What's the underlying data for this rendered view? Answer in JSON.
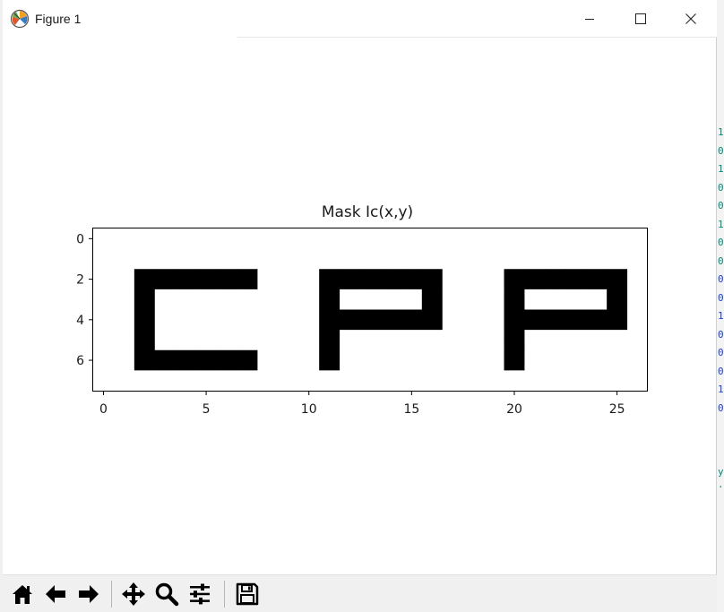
{
  "window": {
    "title": "Figure 1",
    "app_icon": "matplotlib-icon",
    "controls": [
      "minimize-icon",
      "maximize-icon",
      "close-icon"
    ]
  },
  "background_app": {
    "digits_teal": [
      "1",
      "0",
      "1",
      "0",
      "0",
      "1",
      "0",
      "0"
    ],
    "digits_blue": [
      "0",
      "0",
      "1",
      "0",
      "0",
      "0",
      "1",
      "0"
    ],
    "tail": [
      "y",
      "."
    ]
  },
  "chart_data": {
    "type": "heatmap",
    "title": "Mask Ic(x,y)",
    "colormap": "gray_r",
    "rows": 7,
    "cols": 27,
    "xticks": [
      "0",
      "5",
      "10",
      "15",
      "20",
      "25"
    ],
    "yticks": [
      "0",
      "2",
      "4",
      "6"
    ],
    "xlim": [
      -0.5,
      26.5
    ],
    "ylim": [
      -0.5,
      7.5
    ],
    "grid": false,
    "values": [
      [
        0,
        0,
        0,
        0,
        0,
        0,
        0,
        0,
        0,
        0,
        0,
        0,
        0,
        0,
        0,
        0,
        0,
        0,
        0,
        0,
        0,
        0,
        0,
        0,
        0,
        0,
        0
      ],
      [
        0,
        0,
        0,
        0,
        0,
        0,
        0,
        0,
        0,
        0,
        0,
        0,
        0,
        0,
        0,
        0,
        0,
        0,
        0,
        0,
        0,
        0,
        0,
        0,
        0,
        0,
        0
      ],
      [
        0,
        0,
        1,
        1,
        1,
        1,
        1,
        1,
        0,
        0,
        0,
        1,
        1,
        1,
        1,
        1,
        1,
        0,
        0,
        0,
        1,
        1,
        1,
        1,
        1,
        1,
        0
      ],
      [
        0,
        0,
        1,
        0,
        0,
        0,
        0,
        0,
        0,
        0,
        0,
        1,
        0,
        0,
        0,
        0,
        1,
        0,
        0,
        0,
        1,
        0,
        0,
        0,
        0,
        1,
        0
      ],
      [
        0,
        0,
        1,
        0,
        0,
        0,
        0,
        0,
        0,
        0,
        0,
        1,
        1,
        1,
        1,
        1,
        1,
        0,
        0,
        0,
        1,
        1,
        1,
        1,
        1,
        1,
        0
      ],
      [
        0,
        0,
        1,
        0,
        0,
        0,
        0,
        0,
        0,
        0,
        0,
        1,
        0,
        0,
        0,
        0,
        0,
        0,
        0,
        0,
        1,
        0,
        0,
        0,
        0,
        0,
        0
      ],
      [
        0,
        0,
        1,
        1,
        1,
        1,
        1,
        1,
        0,
        0,
        0,
        1,
        0,
        0,
        0,
        0,
        0,
        0,
        0,
        0,
        1,
        0,
        0,
        0,
        0,
        0,
        0
      ],
      [
        0,
        0,
        0,
        0,
        0,
        0,
        0,
        0,
        0,
        0,
        0,
        0,
        0,
        0,
        0,
        0,
        0,
        0,
        0,
        0,
        0,
        0,
        0,
        0,
        0,
        0,
        0
      ]
    ]
  },
  "toolbar": {
    "buttons": [
      "home-icon",
      "back-icon",
      "forward-icon",
      "pan-icon",
      "zoom-icon",
      "configure-subplots-icon",
      "save-icon"
    ]
  }
}
